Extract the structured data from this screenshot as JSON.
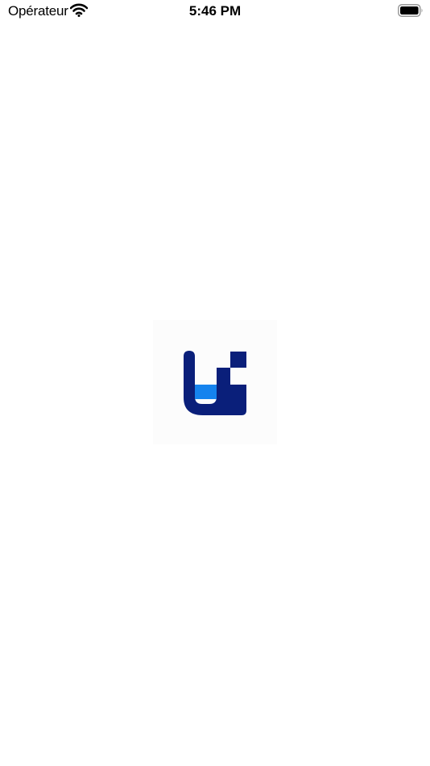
{
  "status_bar": {
    "carrier": "Opérateur",
    "time": "5:46 PM",
    "icons": [
      "wifi-icon",
      "battery-icon"
    ]
  },
  "splash": {
    "logo": "app-logo",
    "colors": {
      "dark_navy": "#0a1f7a",
      "bright_blue": "#1583ee",
      "background": "#ffffff"
    }
  }
}
